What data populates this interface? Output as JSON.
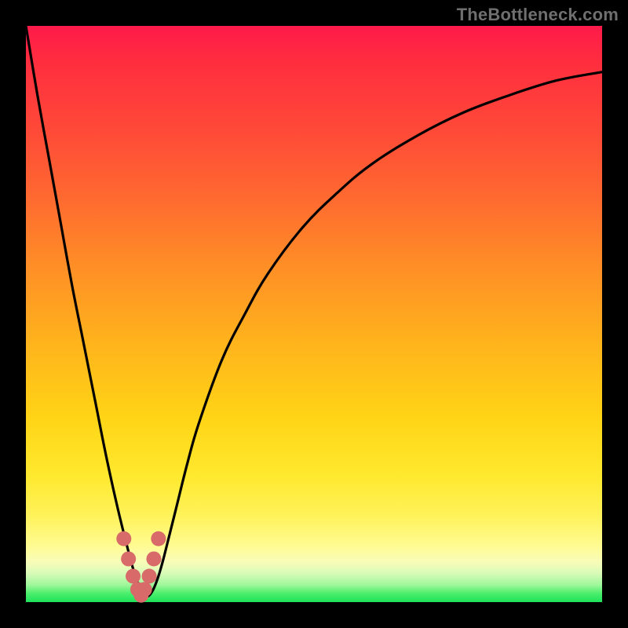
{
  "watermark": "TheBottleneck.com",
  "colors": {
    "curve_stroke": "#000000",
    "marker_fill": "#d86a6a",
    "marker_stroke": "#c85a5a",
    "gradient_top": "#ff1a4a",
    "gradient_bottom": "#1de35a"
  },
  "chart_data": {
    "type": "line",
    "title": "",
    "xlabel": "",
    "ylabel": "",
    "xlim": [
      0,
      100
    ],
    "ylim": [
      0,
      100
    ],
    "series": [
      {
        "name": "bottleneck-curve",
        "x": [
          0,
          2,
          4,
          6,
          8,
          10,
          12,
          14,
          16,
          18,
          19,
          20,
          21,
          22,
          23,
          24,
          26,
          28,
          30,
          34,
          38,
          42,
          48,
          54,
          60,
          68,
          76,
          84,
          92,
          100
        ],
        "y": [
          100,
          88,
          77,
          66,
          55,
          45,
          35,
          25,
          16,
          8,
          4.5,
          2,
          1,
          2,
          4.5,
          8,
          16,
          24,
          31,
          42,
          50,
          57,
          65,
          71,
          76,
          81,
          85,
          88,
          90.5,
          92
        ]
      }
    ],
    "markers": {
      "name": "optimal-range",
      "x": [
        17.0,
        17.8,
        18.6,
        19.4,
        20.0,
        20.6,
        21.4,
        22.2,
        23.0
      ],
      "y": [
        11.0,
        7.5,
        4.5,
        2.2,
        1.2,
        2.2,
        4.5,
        7.5,
        11.0
      ]
    }
  }
}
